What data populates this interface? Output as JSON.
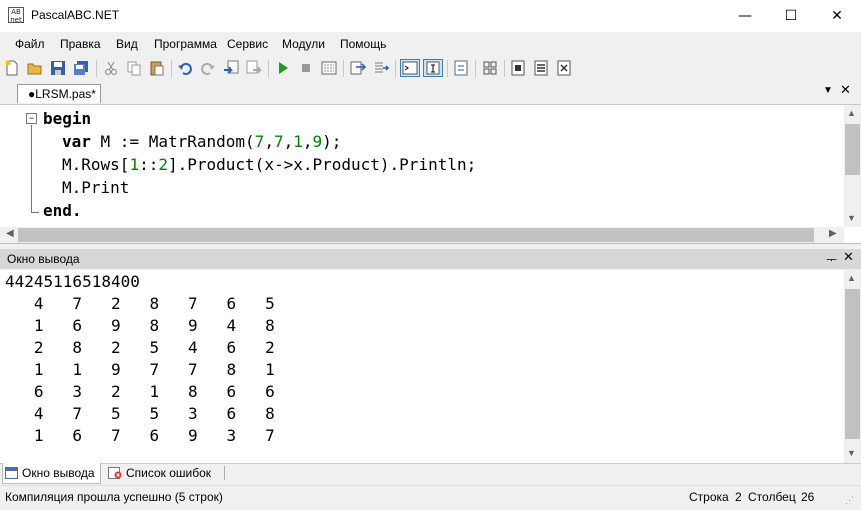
{
  "window": {
    "title": "PascalABC.NET",
    "icon_text": "AB\nnet",
    "controls": [
      "—",
      "☐",
      "✕"
    ]
  },
  "menu": [
    "Файл",
    "Правка",
    "Вид",
    "Программа",
    "Сервис",
    "Модули",
    "Помощь"
  ],
  "toolbar_icons": [
    "new-file-icon",
    "open-icon",
    "save-icon",
    "save-all-icon",
    "cut-icon",
    "copy-icon",
    "paste-icon",
    "undo-icon",
    "redo-icon",
    "navigate-back-icon",
    "navigate-forward-icon",
    "run-icon",
    "stop-icon",
    "compile-icon",
    "debug-step-icon",
    "debug-into-icon",
    "output-toggle-icon",
    "format-icon",
    "compare-icon",
    "grid-icon",
    "db1-icon",
    "db2-icon",
    "db3-icon"
  ],
  "tab": {
    "label": "●LRSM.pas*"
  },
  "editor": {
    "lines": [
      {
        "parts": [
          {
            "t": "begin",
            "c": "kw"
          }
        ],
        "indent": 0
      },
      {
        "parts": [
          {
            "t": "var",
            "c": "kw"
          },
          {
            "t": " M := MatrRandom(",
            "c": ""
          },
          {
            "t": "7",
            "c": "num"
          },
          {
            "t": ",",
            "c": ""
          },
          {
            "t": "7",
            "c": "num"
          },
          {
            "t": ",",
            "c": ""
          },
          {
            "t": "1",
            "c": "num"
          },
          {
            "t": ",",
            "c": ""
          },
          {
            "t": "9",
            "c": "num"
          },
          {
            "t": ");",
            "c": ""
          }
        ],
        "indent": 1
      },
      {
        "parts": [
          {
            "t": "M.Rows[",
            "c": ""
          },
          {
            "t": "1",
            "c": "num"
          },
          {
            "t": "::",
            "c": ""
          },
          {
            "t": "2",
            "c": "num"
          },
          {
            "t": "].Product(x->x.Product).Println;",
            "c": ""
          }
        ],
        "indent": 1
      },
      {
        "parts": [
          {
            "t": "M.Print",
            "c": ""
          }
        ],
        "indent": 1
      },
      {
        "parts": [
          {
            "t": "end.",
            "c": "kw"
          }
        ],
        "indent": 0
      }
    ]
  },
  "output_panel": {
    "title": "Окно вывода",
    "first_line": "44245116518400",
    "matrix": [
      [
        4,
        7,
        2,
        8,
        7,
        6,
        5
      ],
      [
        1,
        6,
        9,
        8,
        9,
        4,
        8
      ],
      [
        2,
        8,
        2,
        5,
        4,
        6,
        2
      ],
      [
        1,
        1,
        9,
        7,
        7,
        8,
        1
      ],
      [
        6,
        3,
        2,
        1,
        8,
        6,
        6
      ],
      [
        4,
        7,
        5,
        5,
        3,
        6,
        8
      ],
      [
        1,
        6,
        7,
        6,
        9,
        3,
        7
      ]
    ]
  },
  "bottom_tabs": [
    "Окно вывода",
    "Список ошибок"
  ],
  "status": {
    "message": "Компиляция прошла успешно (5 строк)",
    "row_label": "Строка",
    "row": "2",
    "col_label": "Столбец",
    "col": "26"
  }
}
